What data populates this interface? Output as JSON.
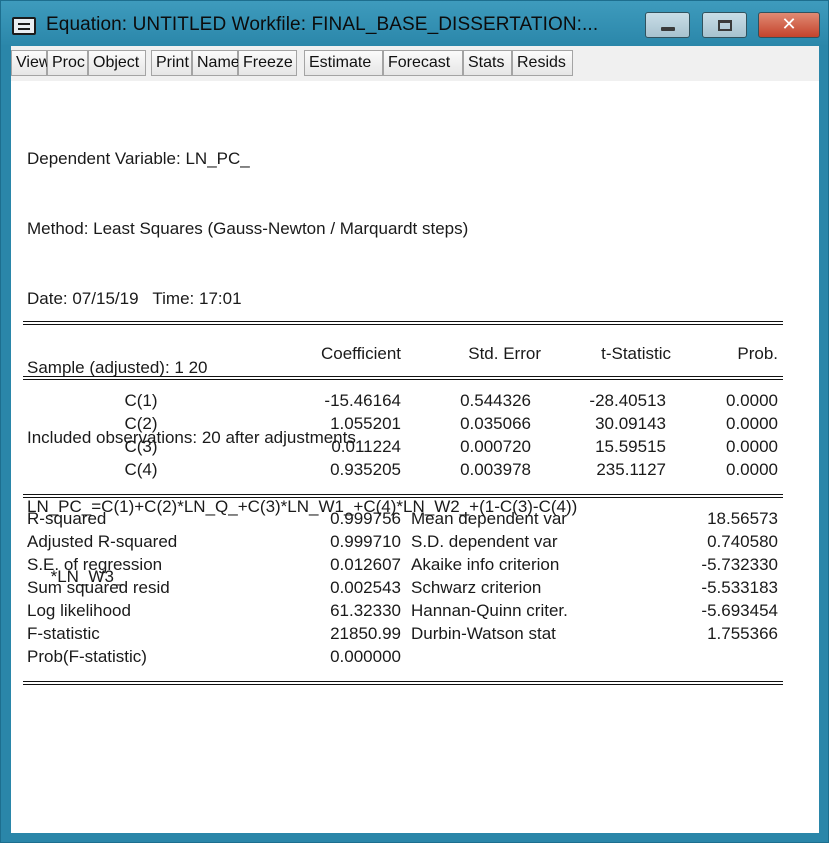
{
  "window": {
    "title": "Equation: UNTITLED   Workfile: FINAL_BASE_DISSERTATION:...",
    "icons": {
      "system_menu": "system-menu-icon",
      "minimize": "minimize-icon",
      "maximize": "maximize-icon",
      "close": "close-icon"
    },
    "close_glyph": "✕"
  },
  "toolbar": {
    "buttons": [
      "View",
      "Proc",
      "Object",
      "Print",
      "Name",
      "Freeze",
      "Estimate",
      "Forecast",
      "Stats",
      "Resids"
    ]
  },
  "output": {
    "header_lines": [
      "Dependent Variable: LN_PC_",
      "Method: Least Squares (Gauss-Newton / Marquardt steps)",
      "Date: 07/15/19   Time: 17:01",
      "Sample (adjusted): 1 20",
      "Included observations: 20 after adjustments",
      "LN_PC_=C(1)+C(2)*LN_Q_+C(3)*LN_W1_+C(4)*LN_W2_+(1-C(3)-C(4))",
      "     *LN_W3_"
    ],
    "columns": [
      "",
      "Coefficient",
      "Std. Error",
      "t-Statistic",
      "Prob."
    ],
    "coefficients": [
      {
        "variable": "C(1)",
        "coefficient": "-15.46164",
        "std_error": "0.544326",
        "t_statistic": "-28.40513",
        "prob": "0.0000"
      },
      {
        "variable": "C(2)",
        "coefficient": "1.055201",
        "std_error": "0.035066",
        "t_statistic": "30.09143",
        "prob": "0.0000"
      },
      {
        "variable": "C(3)",
        "coefficient": "0.011224",
        "std_error": "0.000720",
        "t_statistic": "15.59515",
        "prob": "0.0000"
      },
      {
        "variable": "C(4)",
        "coefficient": "0.935205",
        "std_error": "0.003978",
        "t_statistic": "235.1127",
        "prob": "0.0000"
      }
    ],
    "statistics": [
      {
        "label": "R-squared",
        "value": "0.999756",
        "label2": "Mean dependent var",
        "value2": "18.56573"
      },
      {
        "label": "Adjusted R-squared",
        "value": "0.999710",
        "label2": "S.D. dependent var",
        "value2": "0.740580"
      },
      {
        "label": "S.E. of regression",
        "value": "0.012607",
        "label2": "Akaike info criterion",
        "value2": "-5.732330"
      },
      {
        "label": "Sum squared resid",
        "value": "0.002543",
        "label2": "Schwarz criterion",
        "value2": "-5.533183"
      },
      {
        "label": "Log likelihood",
        "value": "61.32330",
        "label2": "Hannan-Quinn criter.",
        "value2": "-5.693454"
      },
      {
        "label": "F-statistic",
        "value": "21850.99",
        "label2": "Durbin-Watson stat",
        "value2": "1.755366"
      },
      {
        "label": "Prob(F-statistic)",
        "value": "0.000000",
        "label2": "",
        "value2": ""
      }
    ]
  }
}
